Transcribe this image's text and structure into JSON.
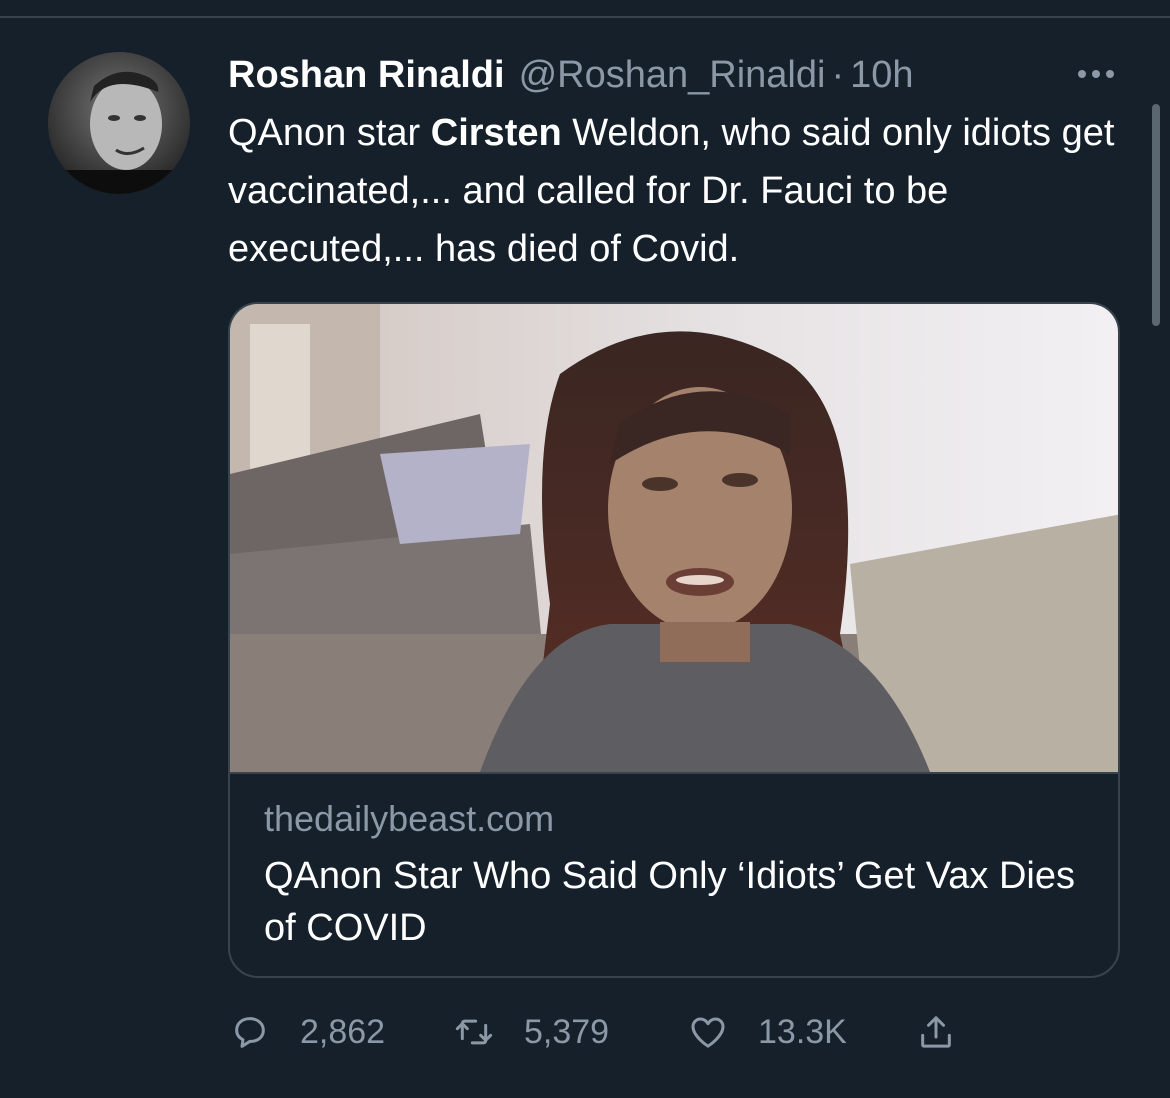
{
  "tweet": {
    "author_name": "Roshan Rinaldi",
    "handle": "@Roshan_Rinaldi",
    "separator": "·",
    "time": "10h",
    "text_part1": "QAnon star ",
    "text_bold": "Cirsten",
    "text_part2": " Weldon, who said only idiots get vaccinated,... and called for Dr. Fauci to be executed,... has died of Covid."
  },
  "card": {
    "domain": "thedailybeast.com",
    "title": "QAnon Star Who Said Only ‘Idiots’ Get Vax Dies of COVID"
  },
  "actions": {
    "replies": "2,862",
    "retweets": "5,379",
    "likes": "13.3K"
  },
  "icons": [
    "more-icon",
    "reply-icon",
    "retweet-icon",
    "like-icon",
    "share-icon"
  ],
  "colors": {
    "background": "#15202b",
    "border": "#38444d",
    "secondary_text": "#8b98a5",
    "primary_text": "#ffffff"
  }
}
